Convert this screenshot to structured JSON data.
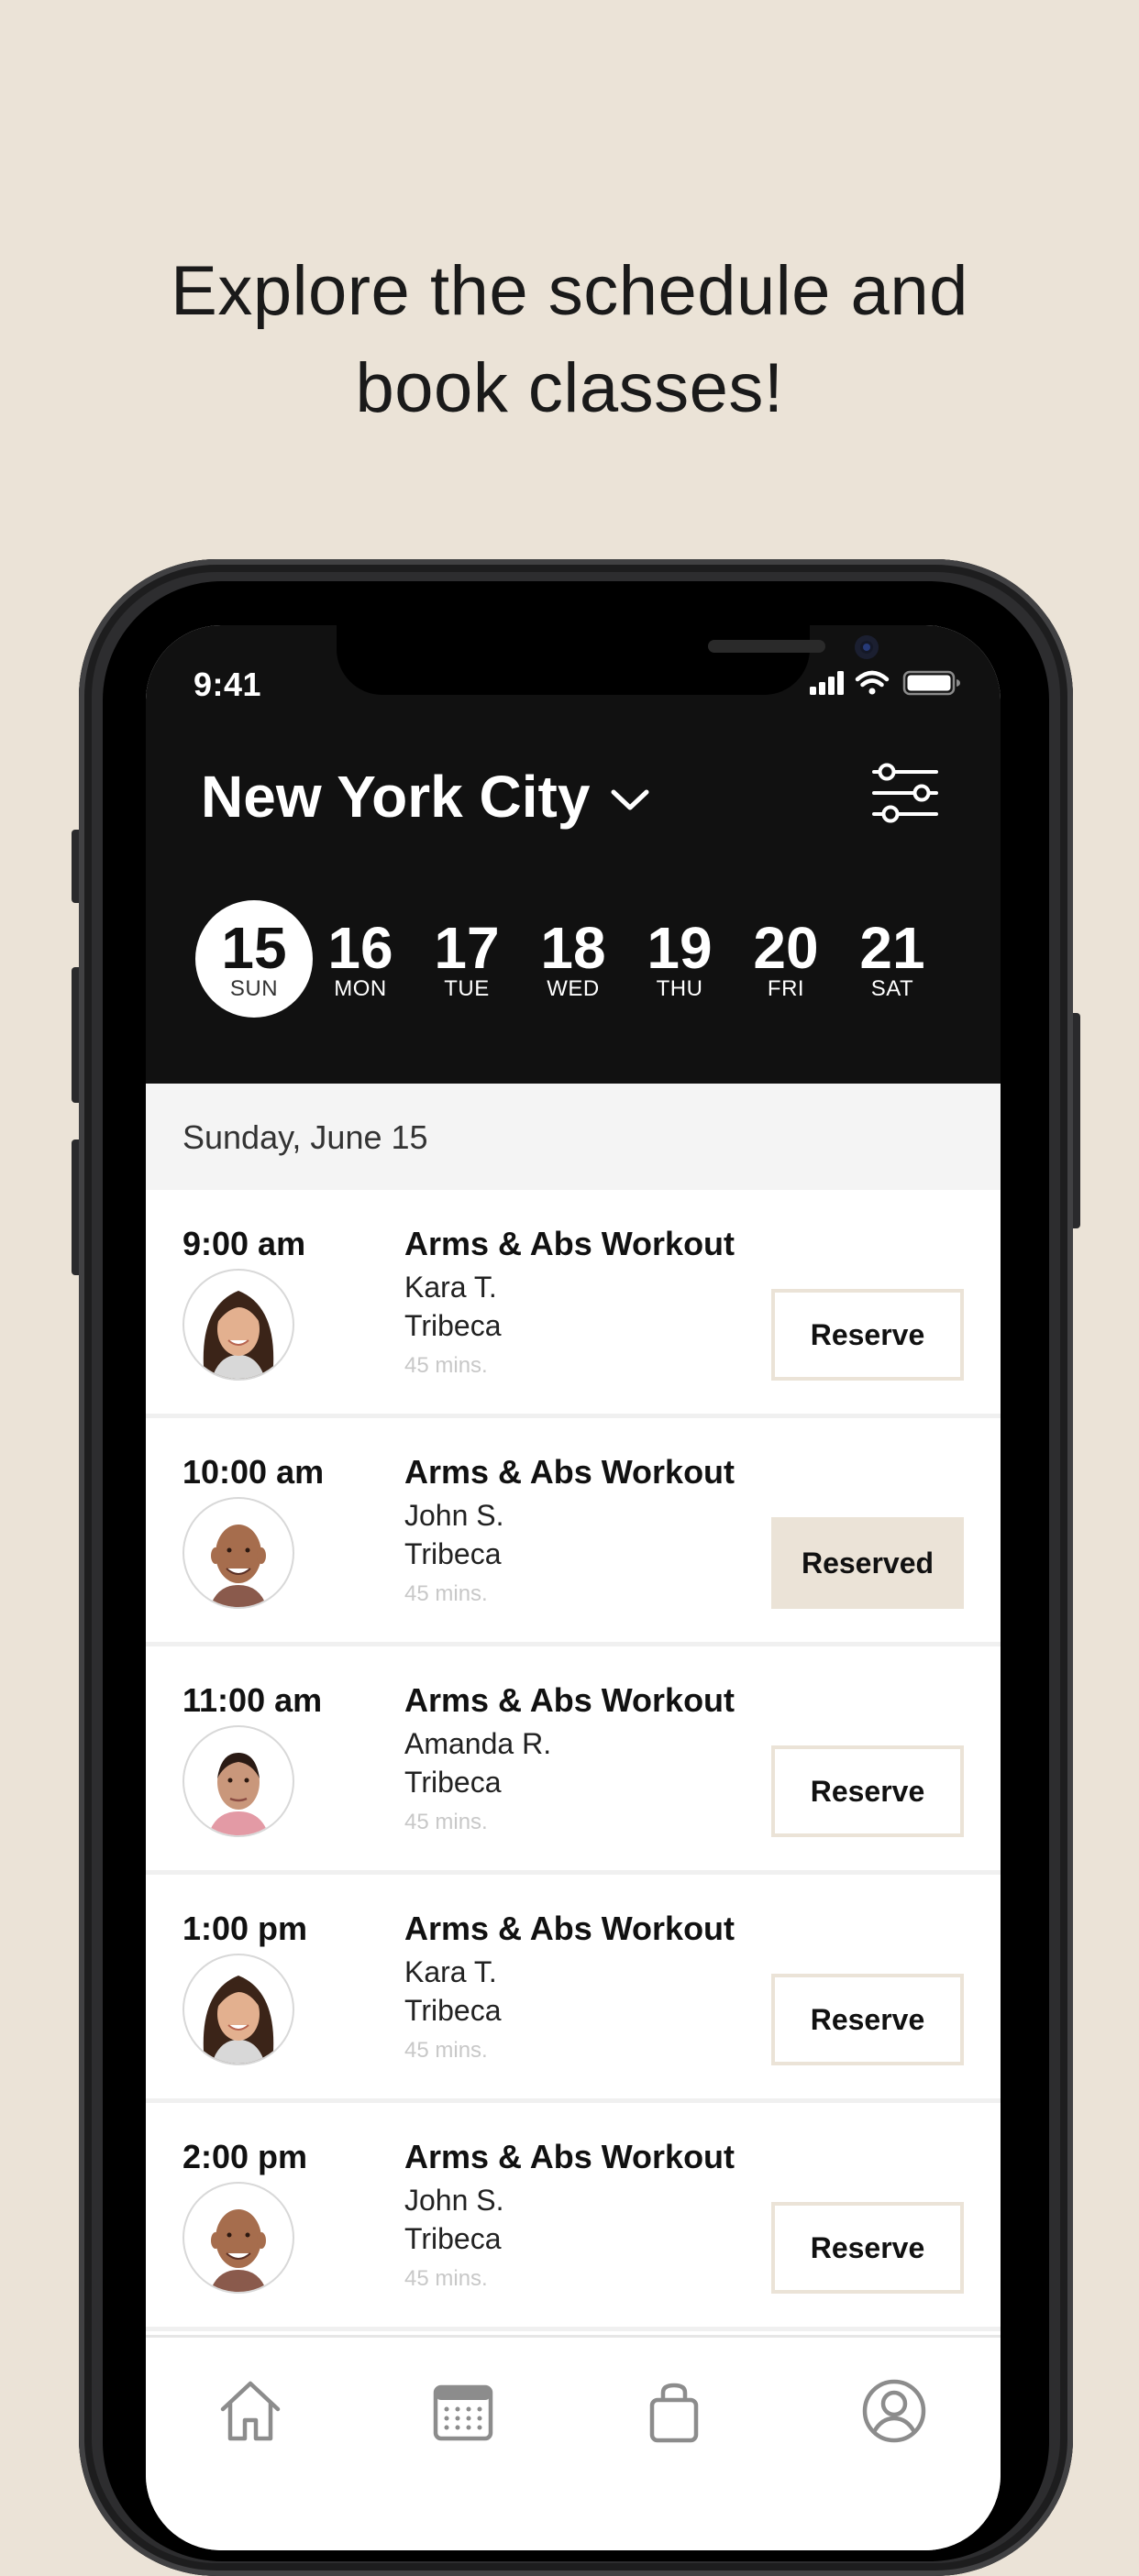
{
  "promo": {
    "headline_line1": "Explore the schedule and",
    "headline_line2": "book classes!"
  },
  "status_bar": {
    "time": "9:41",
    "icons": [
      "signal-icon",
      "wifi-icon",
      "battery-icon"
    ]
  },
  "header": {
    "city": "New York City",
    "icons": [
      "chevron-down-icon",
      "filter-sliders-icon"
    ]
  },
  "days": [
    {
      "num": "15",
      "dow": "SUN",
      "selected": true
    },
    {
      "num": "16",
      "dow": "MON",
      "selected": false
    },
    {
      "num": "17",
      "dow": "TUE",
      "selected": false
    },
    {
      "num": "18",
      "dow": "WED",
      "selected": false
    },
    {
      "num": "19",
      "dow": "THU",
      "selected": false
    },
    {
      "num": "20",
      "dow": "FRI",
      "selected": false
    },
    {
      "num": "21",
      "dow": "SAT",
      "selected": false
    }
  ],
  "selected_date_label": "Sunday, June 15",
  "classes": [
    {
      "time": "9:00 am",
      "title": "Arms & Abs Workout",
      "instructor": "Kara T.",
      "location": "Tribeca",
      "duration": "45 mins.",
      "button": "Reserve",
      "reserved": false
    },
    {
      "time": "10:00 am",
      "title": "Arms & Abs Workout",
      "instructor": "John S.",
      "location": "Tribeca",
      "duration": "45 mins.",
      "button": "Reserved",
      "reserved": true
    },
    {
      "time": "11:00 am",
      "title": "Arms & Abs Workout",
      "instructor": "Amanda R.",
      "location": "Tribeca",
      "duration": "45 mins.",
      "button": "Reserve",
      "reserved": false
    },
    {
      "time": "1:00 pm",
      "title": "Arms & Abs Workout",
      "instructor": "Kara T.",
      "location": "Tribeca",
      "duration": "45 mins.",
      "button": "Reserve",
      "reserved": false
    },
    {
      "time": "2:00 pm",
      "title": "Arms & Abs Workout",
      "instructor": "John S.",
      "location": "Tribeca",
      "duration": "45 mins.",
      "button": "Reserve",
      "reserved": false
    }
  ],
  "tabbar": {
    "icons": [
      "home-icon",
      "calendar-icon",
      "shopping-bag-icon",
      "profile-icon"
    ]
  },
  "colors": {
    "background": "#ebe3d7",
    "header": "#111111",
    "accent_beige": "#ebe3d7",
    "duration_gray": "#c8c8c8"
  }
}
